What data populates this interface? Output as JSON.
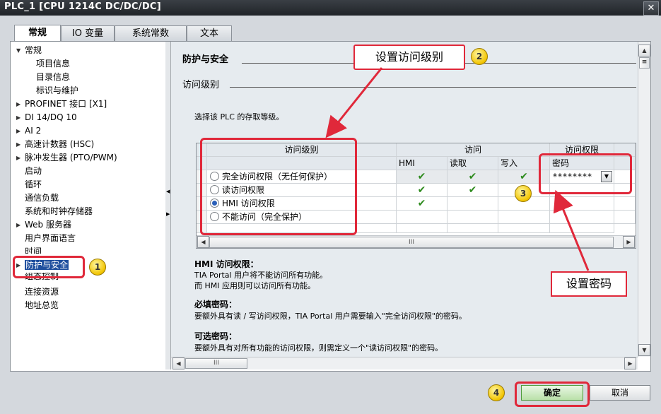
{
  "window": {
    "title": "PLC_1 [CPU 1214C DC/DC/DC]"
  },
  "tabs": [
    {
      "label": "常规"
    },
    {
      "label": "IO 变量"
    },
    {
      "label": "系统常数"
    },
    {
      "label": "文本"
    }
  ],
  "nav": [
    {
      "label": "常规"
    },
    {
      "label": "项目信息"
    },
    {
      "label": "目录信息"
    },
    {
      "label": "标识与维护"
    },
    {
      "label": "PROFINET 接口 [X1]"
    },
    {
      "label": "DI 14/DQ 10"
    },
    {
      "label": "AI 2"
    },
    {
      "label": "高速计数器 (HSC)"
    },
    {
      "label": "脉冲发生器 (PTO/PWM)"
    },
    {
      "label": "启动"
    },
    {
      "label": "循环"
    },
    {
      "label": "通信负载"
    },
    {
      "label": "系统和时钟存储器"
    },
    {
      "label": "Web 服务器"
    },
    {
      "label": "用户界面语言"
    },
    {
      "label": "时间"
    },
    {
      "label": "防护与安全"
    },
    {
      "label": "组态控制"
    },
    {
      "label": "连接资源"
    },
    {
      "label": "地址总览"
    }
  ],
  "content": {
    "section_title": "防护与安全",
    "subsection_title": "访问级别",
    "intro": "选择该 PLC 的存取等级。",
    "table": {
      "headers": {
        "level": "访问级别",
        "access": "访问",
        "permission": "访问权限"
      },
      "subheaders": {
        "hmi": "HMI",
        "read": "读取",
        "write": "写入",
        "password": "密码"
      },
      "rows": [
        {
          "label": "完全访问权限（无任何保护）",
          "selected": false,
          "hmi": true,
          "read": true,
          "write": true,
          "password": "********"
        },
        {
          "label": "读访问权限",
          "selected": false,
          "hmi": true,
          "read": true,
          "write": false,
          "password": ""
        },
        {
          "label": "HMI 访问权限",
          "selected": true,
          "hmi": true,
          "read": false,
          "write": false,
          "password": ""
        },
        {
          "label": "不能访问（完全保护）",
          "selected": false,
          "hmi": false,
          "read": false,
          "write": false,
          "password": ""
        }
      ],
      "check_symbol": "✔",
      "scroll_grip": "III"
    },
    "info": {
      "hmi_heading": "HMI 访问权限：",
      "hmi_line1": "TIA Portal 用户将不能访问所有功能。",
      "hmi_line2": "而 HMI 应用则可以访问所有功能。",
      "req_heading": "必填密码：",
      "req_line1": "要额外具有读 / 写访问权限，TIA Portal 用户需要输入\"完全访问权限\"的密码。",
      "opt_heading": "可选密码：",
      "opt_line1": "要额外具有对所有功能的访问权限，则需定义一个\"读访问权限\"的密码。"
    }
  },
  "callouts": {
    "set_access_level": "设置访问级别",
    "set_password": "设置密码"
  },
  "badges": [
    "1",
    "2",
    "3",
    "4"
  ],
  "buttons": {
    "ok": "确定",
    "cancel": "取消"
  },
  "colors": {
    "callout_red": "#e0283a",
    "check_green": "#2e8b1e",
    "titlebar": "#2a2e33"
  }
}
